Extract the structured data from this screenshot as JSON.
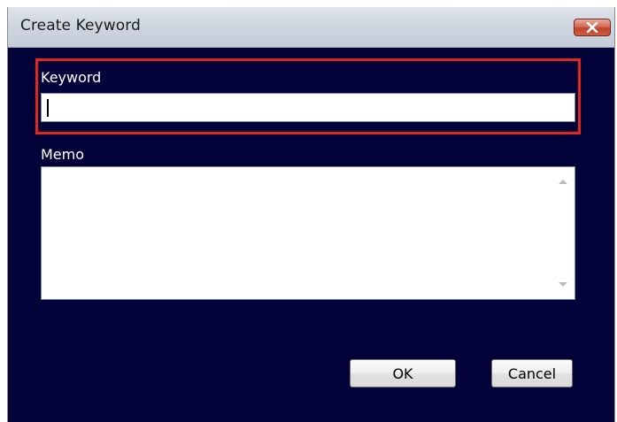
{
  "window": {
    "title": "Create Keyword",
    "close_icon": "close-icon"
  },
  "form": {
    "keyword_label": "Keyword",
    "keyword_value": "",
    "memo_label": "Memo",
    "memo_value": ""
  },
  "buttons": {
    "ok_label": "OK",
    "cancel_label": "Cancel"
  },
  "colors": {
    "dialog_background": "#03033a",
    "highlight_border": "#e2251f",
    "close_button": "#c0442e"
  }
}
